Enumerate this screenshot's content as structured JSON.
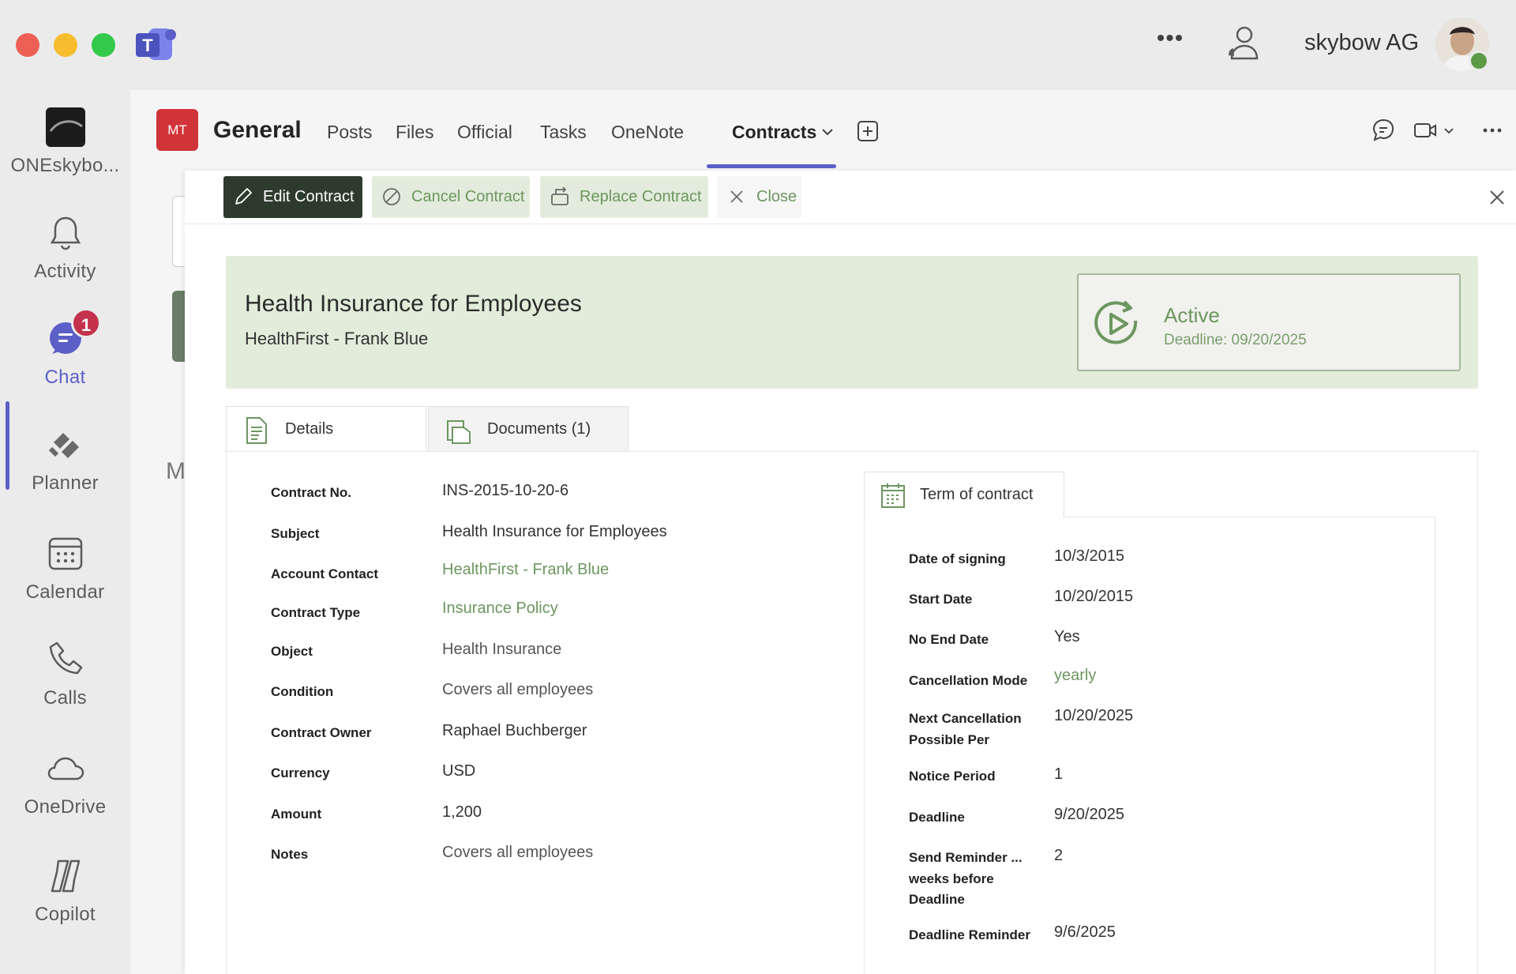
{
  "titlebar": {
    "org_name": "skybow AG"
  },
  "rail": {
    "items": [
      {
        "label": "ONEskybo..."
      },
      {
        "label": "Activity"
      },
      {
        "label": "Chat",
        "badge": "1"
      },
      {
        "label": "Planner"
      },
      {
        "label": "Calendar"
      },
      {
        "label": "Calls"
      },
      {
        "label": "OneDrive"
      },
      {
        "label": "Copilot"
      }
    ]
  },
  "channel": {
    "team_initials": "MT",
    "name": "General",
    "tabs": [
      "Posts",
      "Files",
      "Official",
      "Tasks",
      "OneNote",
      "Contracts"
    ],
    "background_letter": "M"
  },
  "toolbar": {
    "edit": "Edit Contract",
    "cancel": "Cancel Contract",
    "replace": "Replace Contract",
    "close": "Close"
  },
  "contract": {
    "title": "Health Insurance for Employees",
    "subtitle": "HealthFirst - Frank Blue",
    "status": "Active",
    "deadline_text": "Deadline: 09/20/2025"
  },
  "tabs": {
    "details": "Details",
    "documents": "Documents (1)"
  },
  "details": [
    {
      "label": "Contract No.",
      "value": "INS-2015-10-20-6"
    },
    {
      "label": "Subject",
      "value": "Health Insurance for Employees"
    },
    {
      "label": "Account Contact",
      "value": "HealthFirst - Frank Blue"
    },
    {
      "label": "Contract Type",
      "value": "Insurance Policy"
    },
    {
      "label": "Object",
      "value": "Health Insurance"
    },
    {
      "label": "Condition",
      "value": "Covers all employees"
    },
    {
      "label": "Contract Owner",
      "value": "Raphael Buchberger"
    },
    {
      "label": "Currency",
      "value": "USD"
    },
    {
      "label": "Amount",
      "value": "1,200"
    },
    {
      "label": "Notes",
      "value": "Covers all employees"
    }
  ],
  "term": {
    "heading": "Term of contract",
    "rows": [
      {
        "label": "Date of signing",
        "value": "10/3/2015"
      },
      {
        "label": "Start Date",
        "value": "10/20/2015"
      },
      {
        "label": "No End Date",
        "value": "Yes"
      },
      {
        "label": "Cancellation Mode",
        "value": "yearly"
      },
      {
        "label1": "Next Cancellation",
        "label2": "Possible Per",
        "value": "10/20/2025"
      },
      {
        "label": "Notice Period",
        "value": "1"
      },
      {
        "label": "Deadline",
        "value": "9/20/2025"
      },
      {
        "label1": "Send Reminder ...",
        "label2": "weeks before",
        "label3": "Deadline",
        "value": "2"
      },
      {
        "label": "Deadline Reminder",
        "value": "9/6/2025"
      }
    ]
  },
  "colors": {
    "accent": "#5b5fc7",
    "green": "#6d9660",
    "banner": "#e2ecdb",
    "dark_button": "#2d3b2c",
    "team_tile": "#d13438"
  }
}
